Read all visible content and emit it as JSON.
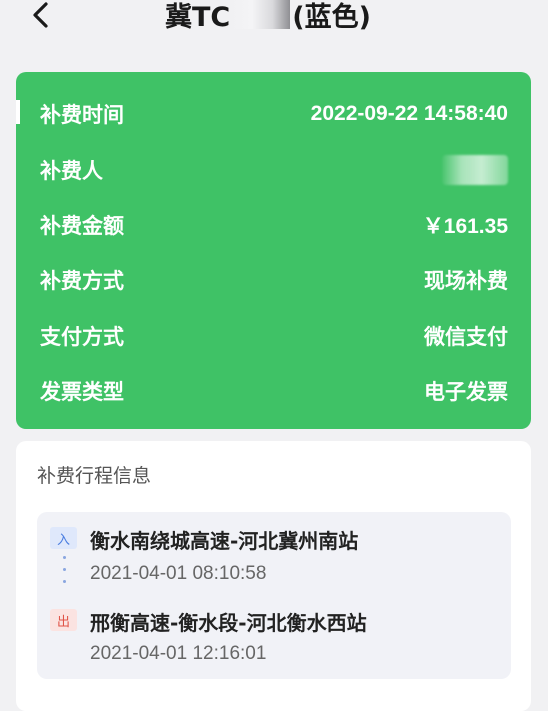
{
  "header": {
    "title_prefix": "冀TC",
    "title_suffix": "(蓝色)"
  },
  "payment": {
    "rows": [
      {
        "label": "补费时间",
        "value": "2022-09-22 14:58:40"
      },
      {
        "label": "补费人",
        "value": ""
      },
      {
        "label": "补费金额",
        "value": "￥161.35"
      },
      {
        "label": "补费方式",
        "value": "现场补费"
      },
      {
        "label": "支付方式",
        "value": "微信支付"
      },
      {
        "label": "发票类型",
        "value": "电子发票"
      }
    ]
  },
  "trip": {
    "title": "补费行程信息",
    "entry": {
      "tag": "入",
      "station": "衡水南绕城高速-河北冀州南站",
      "time": "2021-04-01 08:10:58"
    },
    "exit": {
      "tag": "出",
      "station": "邢衡高速-衡水段-河北衡水西站",
      "time": "2021-04-01 12:16:01"
    }
  },
  "colors": {
    "card_green": "#3fc266",
    "page_bg": "#f1f1f3",
    "entry_tag": "#4a7de0",
    "exit_tag": "#e05347"
  },
  "icons": {
    "back": "chevron-left-icon",
    "route_connector": "dotted-line-icon"
  }
}
